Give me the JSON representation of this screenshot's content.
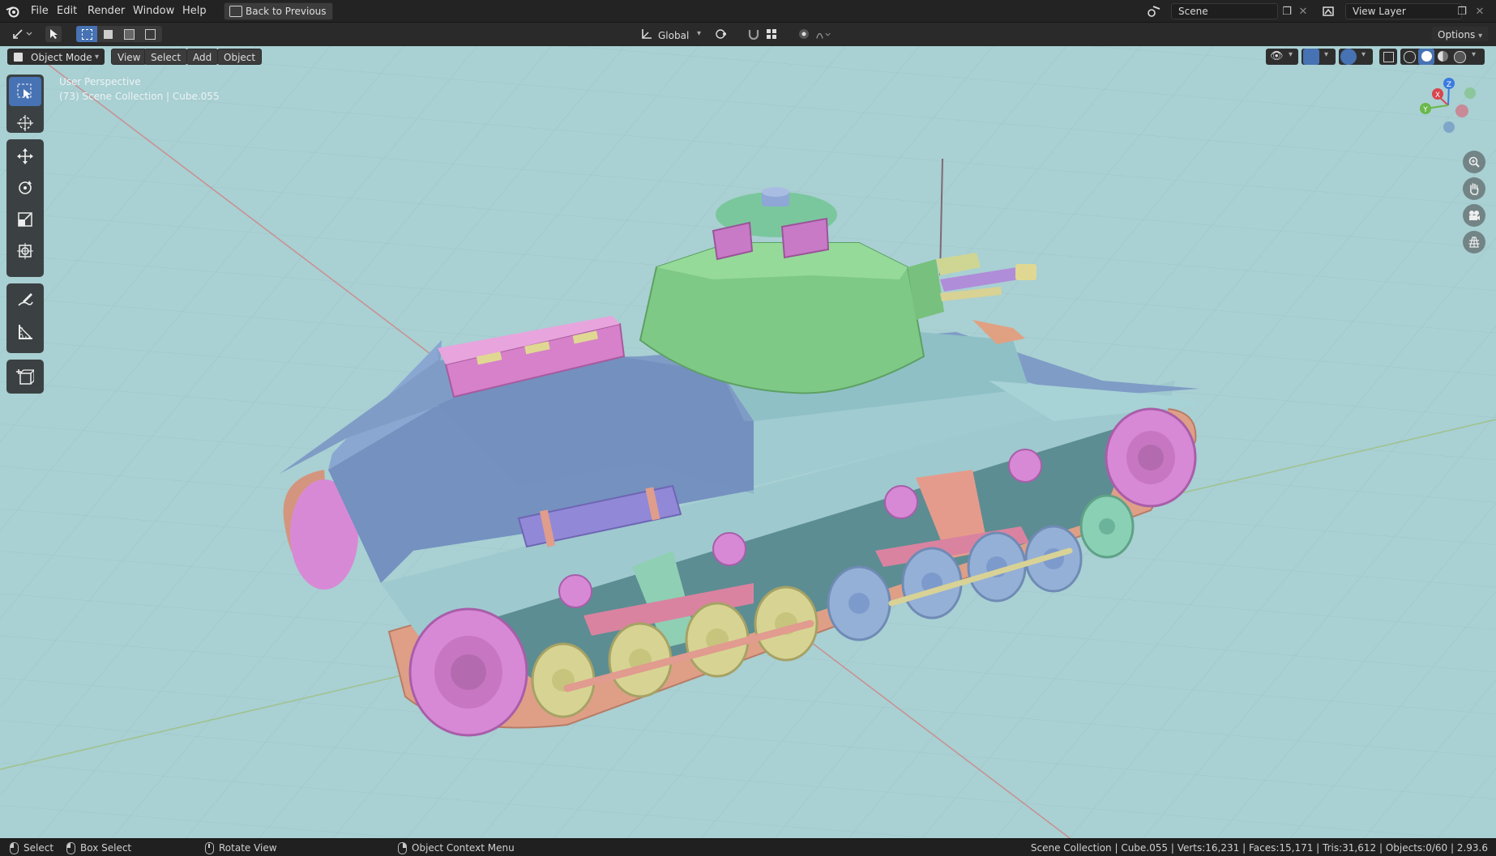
{
  "menubar": {
    "items": [
      "File",
      "Edit",
      "Render",
      "Window",
      "Help"
    ],
    "back_button": "Back to Previous",
    "scene_name": "Scene",
    "view_layer": "View Layer"
  },
  "tool_header": {
    "orientation": "Global",
    "options": "Options"
  },
  "view_header": {
    "mode": "Object Mode",
    "menus": [
      "View",
      "Select",
      "Add",
      "Object"
    ]
  },
  "viewport": {
    "perspective": "User Perspective",
    "collection_line": "(73) Scene Collection | Cube.055",
    "background_color": "#a9d0d3"
  },
  "gizmo": {
    "x": "X",
    "y": "Y",
    "z": "Z"
  },
  "statusbar": {
    "select": "Select",
    "box_select": "Box Select",
    "rotate_view": "Rotate View",
    "context_menu": "Object Context Menu",
    "stats": "Scene Collection | Cube.055 | Verts:16,231 | Faces:15,171 | Tris:31,612 | Objects:0/60 | 2.93.6"
  },
  "icons": {
    "blender_logo": "blender-logo-icon",
    "tools": [
      "select-box-icon",
      "cursor-icon",
      "move-icon",
      "rotate-icon",
      "scale-icon",
      "transform-icon",
      "annotate-icon",
      "measure-icon",
      "add-cube-icon"
    ],
    "nav": [
      "zoom-icon",
      "pan-hand-icon",
      "camera-icon",
      "ortho-grid-icon"
    ]
  },
  "colors": {
    "active_tool": "#4772b3",
    "hull": "#7f9cc6",
    "turret": "#86d08b",
    "track": "#e0a58c",
    "wheel_pink": "#d887d8",
    "wheel_yellow": "#d8d596",
    "wheel_blue": "#94b0d6"
  }
}
